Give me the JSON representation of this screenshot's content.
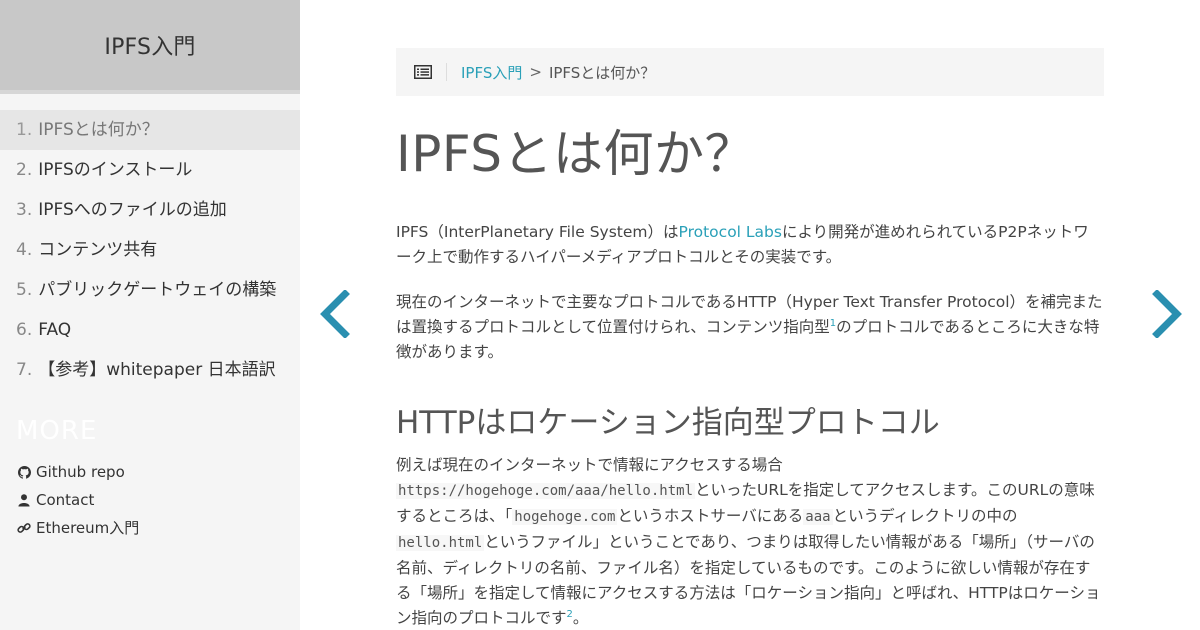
{
  "sidebar": {
    "title": "IPFS入門",
    "items": [
      {
        "num": "1.",
        "label": "IPFSとは何か？"
      },
      {
        "num": "2.",
        "label": "IPFSのインストール"
      },
      {
        "num": "3.",
        "label": "IPFSへのファイルの追加"
      },
      {
        "num": "4.",
        "label": "コンテンツ共有"
      },
      {
        "num": "5.",
        "label": "パブリックゲートウェイの構築"
      },
      {
        "num": "6.",
        "label": "FAQ"
      },
      {
        "num": "7.",
        "label": "【参考】whitepaper 日本語訳"
      }
    ],
    "more_title": "MORE",
    "links": [
      {
        "icon": "github-icon",
        "label": "Github repo"
      },
      {
        "icon": "user-icon",
        "label": "Contact"
      },
      {
        "icon": "link-icon",
        "label": "Ethereum入門"
      }
    ]
  },
  "breadcrumb": {
    "home": "IPFS入門",
    "separator": ">",
    "current": "IPFSとは何か？"
  },
  "article": {
    "title": "IPFSとは何か？",
    "p1": {
      "a": "IPFS（InterPlanetary File System）は",
      "link": "Protocol Labs",
      "b": "により開発が進めれられているP2Pネットワーク上で動作するハイパーメディアプロトコルとその実装です。"
    },
    "p2": {
      "a": "現在のインターネットで主要なプロトコルであるHTTP（Hyper Text Transfer Protocol）を補完または置換するプロトコルとして位置付けられ、コンテンツ指向型",
      "fn": "1",
      "b": "のプロトコルであるところに大きな特徴があります。"
    },
    "h2": "HTTPはロケーション指向型プロトコル",
    "p3": {
      "a": "例えば現在のインターネットで情報にアクセスする場合",
      "code1": "https://hogehoge.com/aaa/hello.html",
      "b": "といったURLを指定してアクセスします。このURLの意味するところは、「",
      "code2": "hogehoge.com",
      "c": "というホストサーバにある",
      "code3": "aaa",
      "d": "というディレクトリの中の",
      "code4": "hello.html",
      "e": "というファイル」ということであり、つまりは取得したい情報がある「場所」（サーバの名前、ディレクトリの名前、ファイル名）を指定しているものです。このように欲しい情報が存在する「場所」を指定して情報にアクセスする方法は「ロケーション指向」と呼ばれ、HTTPはロケーション指向のプロトコルです",
      "fn": "2",
      "f": "。"
    }
  },
  "colors": {
    "accent": "#2aa0b8",
    "sidebar_bg": "#f5f5f5",
    "header_bg": "#c8c8c8"
  }
}
